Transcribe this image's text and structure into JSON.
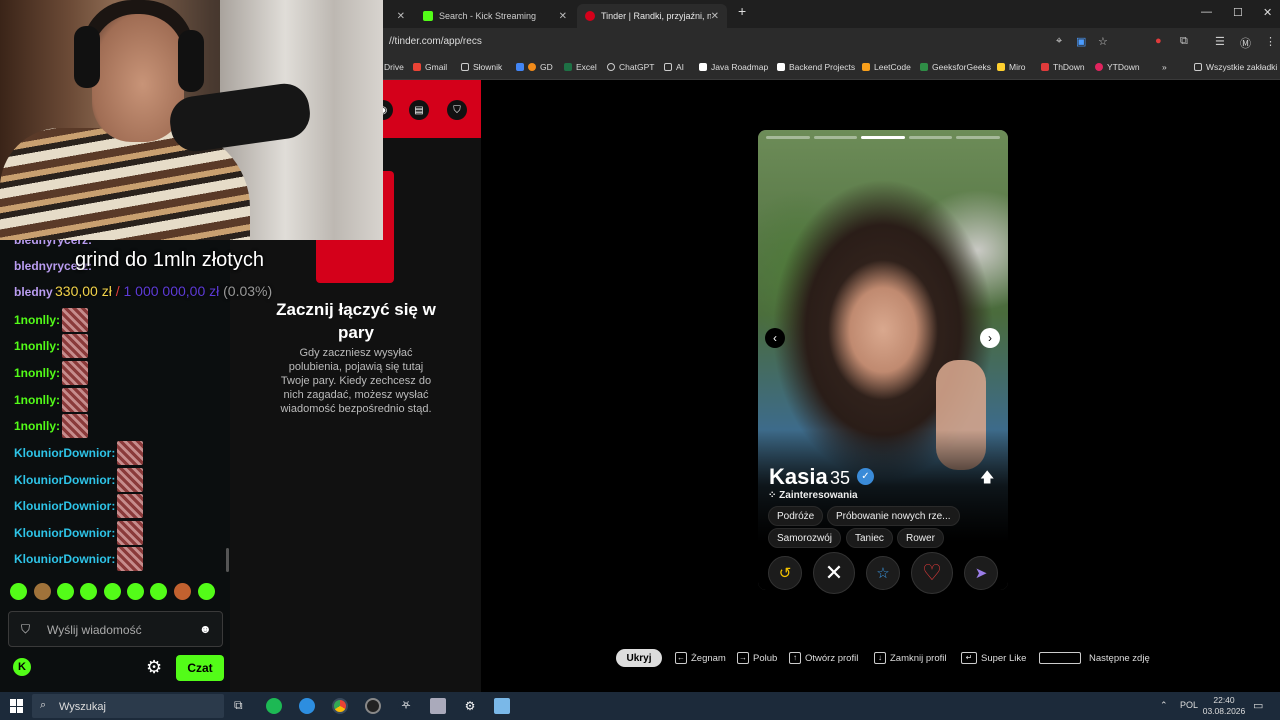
{
  "browser": {
    "tabs": [
      {
        "label": "Search - Kick Streaming",
        "color": "#53fc18"
      },
      {
        "label": "Tinder | Randki, przyjaźni, nowe",
        "color": "#d4001a"
      }
    ],
    "url": "//tinder.com/app/recs",
    "bookmarks": [
      "Drive",
      "Gmail",
      "Słownik",
      "GD",
      "Excel",
      "ChatGPT",
      "AI",
      "Java Roadmap",
      "Backend Projects",
      "LeetCode",
      "GeeksforGeeks",
      "Miro",
      "ThDown",
      "YTDown",
      "Wszystkie zakładki"
    ]
  },
  "tinder": {
    "left": {
      "title": "Zacznij łączyć się w pary",
      "body": "Gdy zaczniesz wysyłać polubienia, pojawią się tutaj Twoje pary. Kiedy zechcesz do nich zagadać, możesz wysłać wiadomość bezpośrednio stąd."
    },
    "profile": {
      "name": "Kasia",
      "age": "35",
      "interests_label": "Zainteresowania",
      "interests": [
        "Podróże",
        "Próbowanie nowych rze...",
        "Samorozwój",
        "Taniec",
        "Rower"
      ],
      "photo_count": 5,
      "photo_index": 3
    },
    "hotkeys": {
      "hide": "Ukryj",
      "items": [
        "Żegnam",
        "Polub",
        "Otwórz profil",
        "Zamknij profil",
        "Super Like",
        "Następne zdję"
      ]
    }
  },
  "chat": {
    "messages": [
      {
        "user": "blednyrycerz:",
        "color": "#b99cf0"
      },
      {
        "user": "blednyrycerz:",
        "color": "#b99cf0"
      },
      {
        "user": "bledny",
        "color": "#b99cf0"
      },
      {
        "user": "1nonlly:",
        "color": "#53fc18"
      },
      {
        "user": "1nonlly:",
        "color": "#53fc18"
      },
      {
        "user": "1nonlly:",
        "color": "#53fc18"
      },
      {
        "user": "1nonlly:",
        "color": "#53fc18"
      },
      {
        "user": "1nonlly:",
        "color": "#53fc18"
      },
      {
        "user": "KlouniorDownior:",
        "color": "#2ec4e8"
      },
      {
        "user": "KlouniorDownior:",
        "color": "#2ec4e8"
      },
      {
        "user": "KlouniorDownior:",
        "color": "#2ec4e8"
      },
      {
        "user": "KlouniorDownior:",
        "color": "#2ec4e8"
      },
      {
        "user": "KlouniorDownior:",
        "color": "#2ec4e8"
      }
    ],
    "input_placeholder": "Wyślij wiadomość",
    "send_label": "Czat"
  },
  "overlay": {
    "goal_title": "grind do 1mln złotych",
    "current": "330,00 zł",
    "separator": "/",
    "total": "1 000 000,00 zł",
    "percent": "(0.03%)"
  },
  "taskbar": {
    "search": "Wyszukaj",
    "lang": "POL",
    "time": "22:40",
    "date": "03.08.2026"
  }
}
